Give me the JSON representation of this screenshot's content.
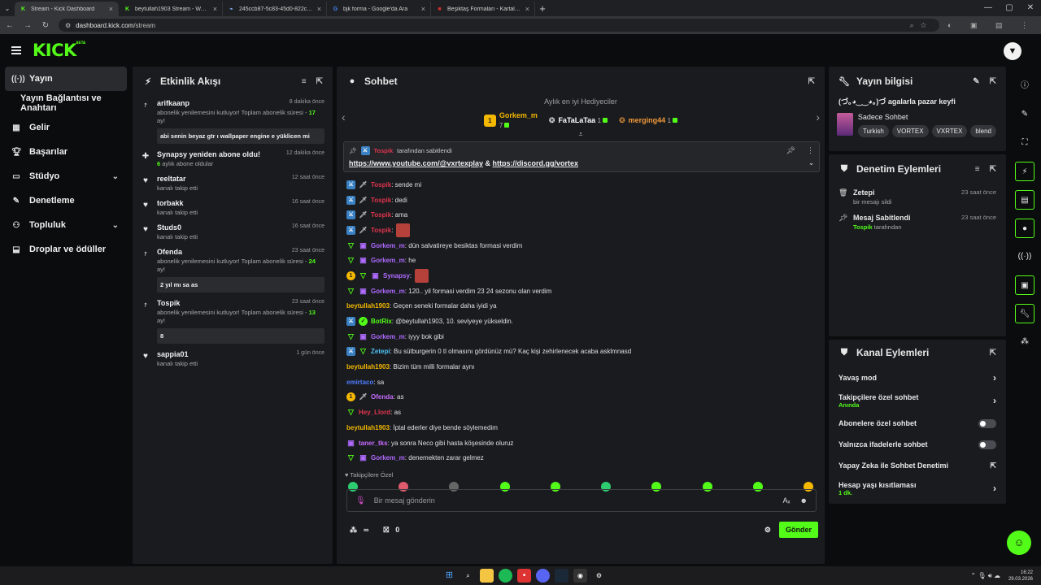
{
  "browser": {
    "tabs": [
      {
        "title": "Stream - Kick Dashboard",
        "fav": "K",
        "favColor": "#53fc18",
        "active": true
      },
      {
        "title": "beytullah1903 Stream - Watch",
        "fav": "K",
        "favColor": "#53fc18",
        "active": false
      },
      {
        "title": "245ccb87-5c83-45d0-822c-7b",
        "fav": "⌁",
        "favColor": "#8ab4f8",
        "active": false
      },
      {
        "title": "bjk forma - Google'da Ara",
        "fav": "G",
        "favColor": "#4285f4",
        "active": false
      },
      {
        "title": "Beşiktaş Formaları - Kartal Yuva",
        "fav": "■",
        "favColor": "#d32f2f",
        "active": false
      }
    ],
    "url_host": "dashboard.kick.com",
    "url_path": "/stream"
  },
  "brand": {
    "logo": "KICK",
    "beta": "BETA"
  },
  "sidebar": {
    "items": [
      {
        "label": "Yayın",
        "icon": "broadcast-icon",
        "glyph": "((·))",
        "active": true
      },
      {
        "label": "Yayın Bağlantısı ve Anahtarı",
        "icon": "",
        "glyph": "",
        "active": false
      },
      {
        "label": "Gelir",
        "icon": "revenue-icon",
        "glyph": "▦",
        "active": false
      },
      {
        "label": "Başarılar",
        "icon": "trophy-icon",
        "glyph": "🏆︎",
        "active": false
      },
      {
        "label": "Stüdyo",
        "icon": "studio-icon",
        "glyph": "▭",
        "active": false,
        "chevron": true
      },
      {
        "label": "Denetleme",
        "icon": "wrench-icon",
        "glyph": "✎",
        "active": false
      },
      {
        "label": "Topluluk",
        "icon": "community-icon",
        "glyph": "⚇",
        "active": false,
        "chevron": true
      },
      {
        "label": "Droplar ve ödüller",
        "icon": "drops-icon",
        "glyph": "⬓",
        "active": false
      }
    ]
  },
  "activity": {
    "title": "Etkinlik Akışı",
    "items": [
      {
        "icon": "resub-icon",
        "glyph": "⭎",
        "name": "arifkaanp",
        "time": "8 dakika önce",
        "desc_pre": "abonelik yenilemesini kutluyor! Toplam abonelik süresi - ",
        "highlight": "17",
        "desc_post": " ay!",
        "msg": "abi senin beyaz gtr ı wallpaper engine e yüklicen mi"
      },
      {
        "icon": "gift-sub-icon",
        "glyph": "✚",
        "name": "Synapsy yeniden abone oldu!",
        "time": "12 dakika önce",
        "desc_pre": "",
        "highlight": "6",
        "desc_post": " aylık abone oldular",
        "msg": ""
      },
      {
        "icon": "heart-icon",
        "glyph": "♥",
        "name": "reeltatar",
        "time": "12 saat önce",
        "desc_pre": "kanalı takip etti",
        "highlight": "",
        "desc_post": "",
        "msg": ""
      },
      {
        "icon": "heart-icon",
        "glyph": "♥",
        "name": "torbakk",
        "time": "16 saat önce",
        "desc_pre": "kanalı takip etti",
        "highlight": "",
        "desc_post": "",
        "msg": ""
      },
      {
        "icon": "heart-icon",
        "glyph": "♥",
        "name": "Studs0",
        "time": "16 saat önce",
        "desc_pre": "kanalı takip etti",
        "highlight": "",
        "desc_post": "",
        "msg": ""
      },
      {
        "icon": "resub-icon",
        "glyph": "⭎",
        "name": "Ofenda",
        "time": "23 saat önce",
        "desc_pre": "abonelik yenilemesini kutluyor! Toplam abonelik süresi - ",
        "highlight": "24",
        "desc_post": " ay!",
        "msg": "2 yıl mı sa as"
      },
      {
        "icon": "resub-icon",
        "glyph": "⭎",
        "name": "Tospik",
        "time": "23 saat önce",
        "desc_pre": "abonelik yenilemesini kutluyor! Toplam abonelik süresi - ",
        "highlight": "13",
        "desc_post": " ay!",
        "msg": "8"
      },
      {
        "icon": "heart-icon",
        "glyph": "♥",
        "name": "sappia01",
        "time": "1 gün önce",
        "desc_pre": "kanalı takip etti",
        "highlight": "",
        "desc_post": "",
        "msg": ""
      }
    ]
  },
  "chat": {
    "title": "Sohbet",
    "gifters_label": "Aylık en iyi Hediyeciler",
    "gifters": [
      {
        "rank": "1",
        "name": "Gorkem_m",
        "count": "7",
        "color": "#f5b800"
      },
      {
        "rank": "",
        "name": "FaTaLaTaa",
        "count": "1",
        "color": "#ffffff"
      },
      {
        "rank": "",
        "name": "merging44",
        "count": "1",
        "color": "#f29a3a"
      }
    ],
    "pinned": {
      "user": "Tospik",
      "by_suffix": "tarafından sabitlendi",
      "link1": "https://www.youtube.com/@vxrtexplay",
      "amp": "&",
      "link2": "https://discord.gg/vortex"
    },
    "messages": [
      {
        "badges": [
          "mod",
          "sword"
        ],
        "user": "Tospik",
        "color": "#e0344d",
        "text": ": sende mi"
      },
      {
        "badges": [
          "mod",
          "sword"
        ],
        "user": "Tospik",
        "color": "#e0344d",
        "text": ": dedi"
      },
      {
        "badges": [
          "mod",
          "sword"
        ],
        "user": "Tospik",
        "color": "#e0344d",
        "text": ": ama"
      },
      {
        "badges": [
          "mod",
          "sword"
        ],
        "user": "Tospik",
        "color": "#e0344d",
        "text": ":",
        "emote": true
      },
      {
        "badges": [
          "v",
          "sub"
        ],
        "user": "Gorkem_m",
        "color": "#b06bff",
        "text": ": dün salvatireye besiktas formasi verdim"
      },
      {
        "badges": [
          "v",
          "sub"
        ],
        "user": "Gorkem_m",
        "color": "#b06bff",
        "text": ": he"
      },
      {
        "badges": [
          "gold",
          "v",
          "sub"
        ],
        "user": "Synapsy",
        "color": "#b06bff",
        "text": ":",
        "emote": true
      },
      {
        "badges": [
          "v",
          "sub"
        ],
        "user": "Gorkem_m",
        "color": "#b06bff",
        "text": ": 120.. yil formasi verdim 23 24 sezonu olan verdim"
      },
      {
        "badges": [],
        "user": "beytullah1903",
        "color": "#f5b800",
        "text": ": Geçen seneki formalar daha iyidi ya"
      },
      {
        "badges": [
          "mod",
          "bot"
        ],
        "user": "BotRix",
        "color": "#53fc18",
        "text": ": @beytullah1903, 10. seviyeye yükseldin."
      },
      {
        "badges": [
          "v",
          "sub"
        ],
        "user": "Gorkem_m",
        "color": "#b06bff",
        "text": ": iyyy bok gibi"
      },
      {
        "badges": [
          "mod",
          "v"
        ],
        "user": "Zetepi",
        "color": "#4fc3f7",
        "text": ": Bu sütburgerin 0 tl olmasını gördünüz mü? Kaç kişi zehirlenecek acaba asklmnasd"
      },
      {
        "badges": [],
        "user": "beytullah1903",
        "color": "#f5b800",
        "text": ": Bizim tüm milli formalar aynı"
      },
      {
        "badges": [],
        "user": "emirtaco",
        "color": "#4f7dff",
        "text": ": sa"
      },
      {
        "badges": [
          "gold",
          "sword"
        ],
        "user": "Ofenda",
        "color": "#c86bff",
        "text": ": as"
      },
      {
        "badges": [
          "v"
        ],
        "user": "Hey_Llord",
        "color": "#e0344d",
        "text": ": as"
      },
      {
        "badges": [],
        "user": "beytullah1903",
        "color": "#f5b800",
        "text": ": İptal ederler diye bende söylemedim"
      },
      {
        "badges": [
          "sub"
        ],
        "user": "taner_tks",
        "color": "#c86bff",
        "text": ": ya sonra Neco gibi hasta köşesinde oluruz"
      },
      {
        "badges": [
          "v",
          "sub"
        ],
        "user": "Gorkem_m",
        "color": "#b06bff",
        "text": ": denemekten zarar gelmez"
      }
    ],
    "followers_only": "♥ Takipçilere Özel",
    "input_placeholder": "Bir mesaj gönderin",
    "points": "∞",
    "gift_count": "0",
    "send_label": "Gönder"
  },
  "stream_info": {
    "title": "Yayın bilgisi",
    "stream_title": "(づ｡◕‿‿◕｡)づ agalarla pazar keyfi",
    "category": "Sadece Sohbet",
    "tags": [
      "Turkish",
      "VORTEX",
      "VXRTEX",
      "blend"
    ]
  },
  "mod_actions": {
    "title": "Denetim Eylemleri",
    "items": [
      {
        "icon": "trash-icon",
        "glyph": "🗑︎",
        "name": "Zetepi",
        "sub_pre": "bir mesajı sildi",
        "sub_hl": "",
        "sub_post": "",
        "time": "23 saat önce"
      },
      {
        "icon": "pin-icon",
        "glyph": "📌︎",
        "name": "Mesaj Sabitlendi",
        "sub_pre": "",
        "sub_hl": "Tospik",
        "sub_post": " tarafından",
        "time": "23 saat önce"
      }
    ]
  },
  "channel_actions": {
    "title": "Kanal Eylemleri",
    "items": [
      {
        "label": "Yavaş mod",
        "sub": "",
        "control": "chevron"
      },
      {
        "label": "Takipçilere özel sohbet",
        "sub": "Anında",
        "control": "chevron"
      },
      {
        "label": "Abonelere özel sohbet",
        "sub": "",
        "control": "toggle"
      },
      {
        "label": "Yalnızca ifadelerle sohbet",
        "sub": "",
        "control": "toggle"
      },
      {
        "label": "Yapay Zeka ile Sohbet Denetimi",
        "sub": "",
        "control": "external"
      },
      {
        "label": "Hesap yaşı kısıtlaması",
        "sub": "1 dk.",
        "control": "chevron"
      }
    ]
  },
  "taskbar": {
    "time": "16:22",
    "date": "29.03.2026"
  },
  "colors": {
    "accent": "#53fc18",
    "panel": "#191b1f",
    "bg": "#0b0c0d"
  }
}
